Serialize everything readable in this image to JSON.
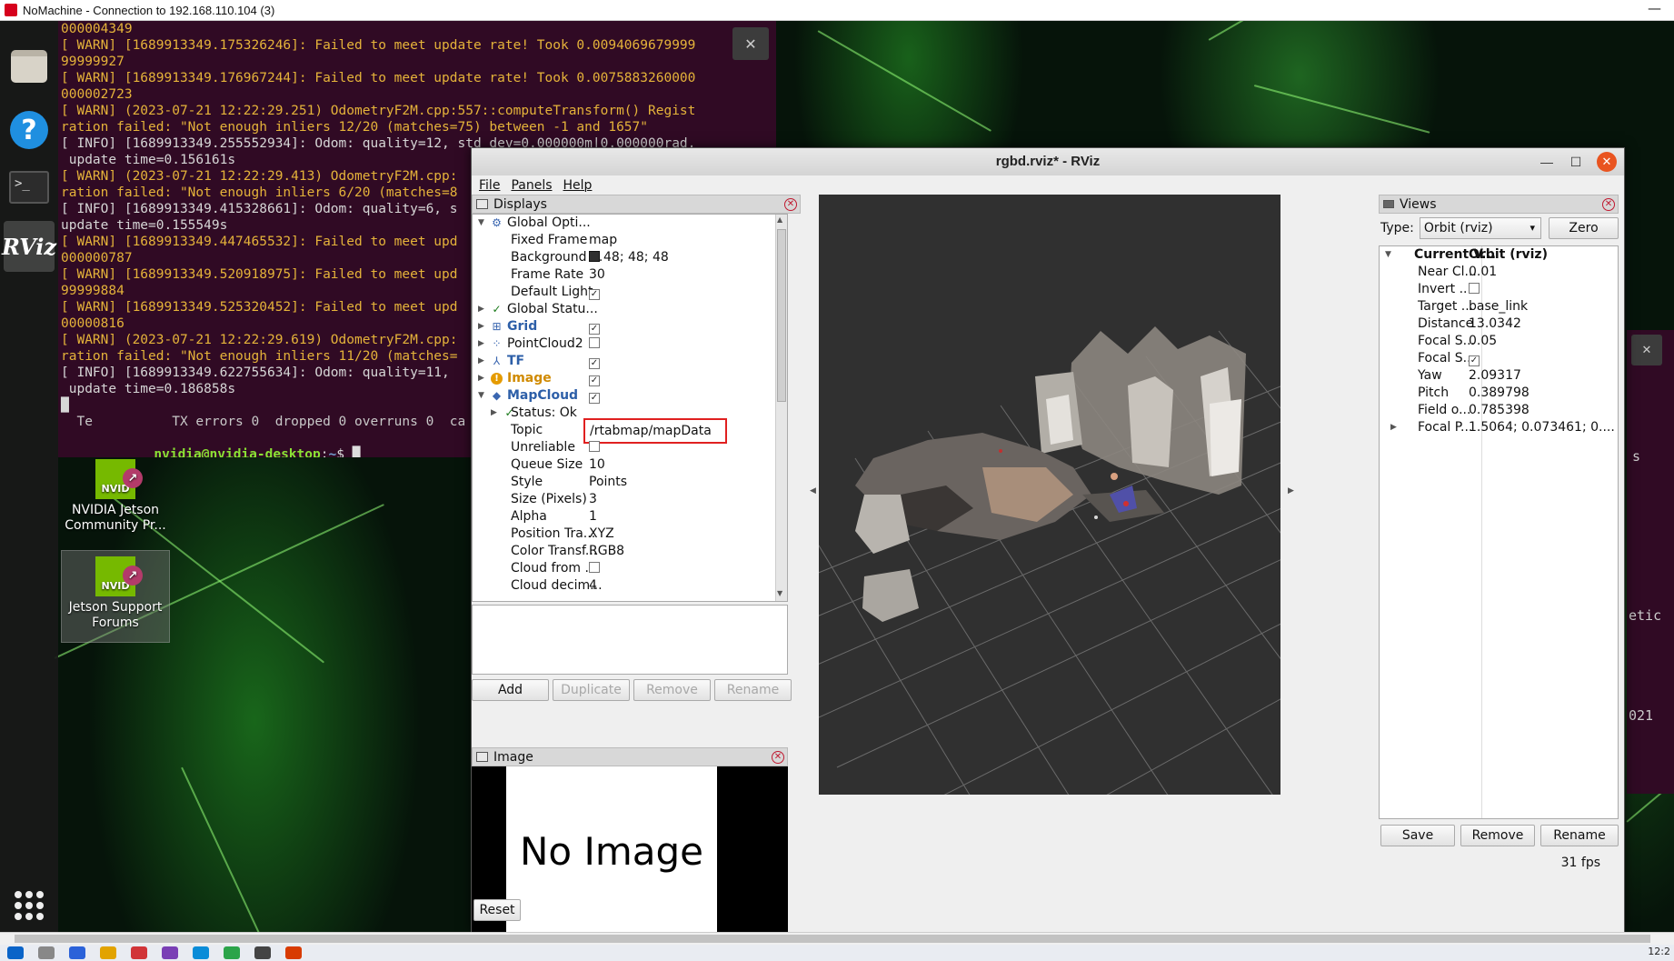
{
  "nomachine": {
    "title": "NoMachine - Connection to 192.168.110.104 (3)"
  },
  "terminal": {
    "lines": [
      {
        "text": "000004349",
        "kind": "warn"
      },
      {
        "text": "[ WARN] [1689913349.175326246]: Failed to meet update rate! Took 0.0094069679999",
        "kind": "warn"
      },
      {
        "text": "99999927",
        "kind": "warn"
      },
      {
        "text": "[ WARN] [1689913349.176967244]: Failed to meet update rate! Took 0.0075883260000",
        "kind": "warn"
      },
      {
        "text": "000002723",
        "kind": "warn"
      },
      {
        "text": "[ WARN] (2023-07-21 12:22:29.251) OdometryF2M.cpp:557::computeTransform() Regist",
        "kind": "warn"
      },
      {
        "text": "ration failed: \"Not enough inliers 12/20 (matches=75) between -1 and 1657\"",
        "kind": "warn"
      },
      {
        "text": "[ INFO] [1689913349.255552934]: Odom: quality=12, std dev=0.000000m|0.000000rad,",
        "kind": "info"
      },
      {
        "text": " update time=0.156161s",
        "kind": "info"
      },
      {
        "text": "[ WARN] (2023-07-21 12:22:29.413) OdometryF2M.cpp:",
        "kind": "warn"
      },
      {
        "text": "ration failed: \"Not enough inliers 6/20 (matches=8",
        "kind": "warn"
      },
      {
        "text": "[ INFO] [1689913349.415328661]: Odom: quality=6, s",
        "kind": "info"
      },
      {
        "text": "update time=0.155549s",
        "kind": "info"
      },
      {
        "text": "[ WARN] [1689913349.447465532]: Failed to meet upd",
        "kind": "warn"
      },
      {
        "text": "000000787",
        "kind": "warn"
      },
      {
        "text": "[ WARN] [1689913349.520918975]: Failed to meet upd",
        "kind": "warn"
      },
      {
        "text": "99999884",
        "kind": "warn"
      },
      {
        "text": "[ WARN] [1689913349.525320452]: Failed to meet upd",
        "kind": "warn"
      },
      {
        "text": "00000816",
        "kind": "warn"
      },
      {
        "text": "[ WARN] (2023-07-21 12:22:29.619) OdometryF2M.cpp:",
        "kind": "warn"
      },
      {
        "text": "ration failed: \"Not enough inliers 11/20 (matches=",
        "kind": "warn"
      },
      {
        "text": "[ INFO] [1689913349.622755634]: Odom: quality=11,",
        "kind": "info"
      },
      {
        "text": " update time=0.186858s",
        "kind": "info"
      },
      {
        "text": "█",
        "kind": "info"
      },
      {
        "text": "  Te          TX errors 0  dropped 0 overruns 0  ca",
        "kind": "dim"
      }
    ],
    "prompt_user": "nvidia@nvidia-desktop",
    "prompt_sep": ":",
    "prompt_path": "~",
    "prompt_end": "$ ",
    "cursor": "█",
    "close_glyph": "✕"
  },
  "desktop_icons": [
    {
      "label": "NVIDIA Jetson Community Pr...",
      "badge": "NVID"
    },
    {
      "label": "Jetson Support Forums",
      "badge": "NVID"
    }
  ],
  "dock": {
    "rviz_label": "RViz",
    "help_glyph": "?",
    "term_glyph": ">_"
  },
  "rviz": {
    "title": "rgbd.rviz* - RViz",
    "window_controls": {
      "minimize": "—",
      "maximize": "☐",
      "close": "✕"
    },
    "menu": [
      "File",
      "Panels",
      "Help"
    ],
    "displays_panel": {
      "title": "Displays",
      "rows": [
        {
          "arrow": "▼",
          "icon": "⚙",
          "label": "Global Opti...",
          "value": "",
          "level": 0
        },
        {
          "label": "Fixed Frame",
          "value": "map",
          "level": 1
        },
        {
          "label": "Background ...",
          "value": "48; 48; 48",
          "swatch": "#303030",
          "level": 1
        },
        {
          "label": "Frame Rate",
          "value": "30",
          "level": 1
        },
        {
          "label": "Default Light",
          "check": true,
          "level": 1
        },
        {
          "arrow": "▶",
          "icon": "✓",
          "label": "Global Statu...",
          "value": "",
          "level": 0
        },
        {
          "arrow": "▶",
          "icon": "⊞",
          "label": "Grid",
          "check": true,
          "style": "bold",
          "level": 0
        },
        {
          "arrow": "▶",
          "icon": "⁘",
          "label": "PointCloud2",
          "check": false,
          "level": 0
        },
        {
          "arrow": "▶",
          "icon": "⅄",
          "label": "TF",
          "check": true,
          "style": "bold",
          "level": 0
        },
        {
          "arrow": "▶",
          "icon": "!",
          "label": "Image",
          "check": true,
          "style": "orange",
          "level": 0
        },
        {
          "arrow": "▼",
          "icon": "◆",
          "label": "MapCloud",
          "check": true,
          "style": "bold",
          "level": 0
        },
        {
          "arrow": "▶",
          "icon": "✓",
          "label": "Status: Ok",
          "value": "",
          "level": 1
        },
        {
          "label": "Topic",
          "value": "/rtabmap/mapData",
          "highlight": true,
          "level": 1
        },
        {
          "label": "Unreliable",
          "check": false,
          "level": 1
        },
        {
          "label": "Queue Size",
          "value": "10",
          "level": 1
        },
        {
          "label": "Style",
          "value": "Points",
          "level": 1
        },
        {
          "label": "Size (Pixels)",
          "value": "3",
          "level": 1
        },
        {
          "label": "Alpha",
          "value": "1",
          "level": 1
        },
        {
          "label": "Position Tra...",
          "value": "XYZ",
          "level": 1
        },
        {
          "label": "Color Transf...",
          "value": "RGB8",
          "level": 1
        },
        {
          "label": "Cloud from ...",
          "check": false,
          "level": 1
        },
        {
          "label": "Cloud decim...",
          "value": "4",
          "level": 1
        }
      ],
      "buttons": {
        "add": "Add",
        "duplicate": "Duplicate",
        "remove": "Remove",
        "rename": "Rename"
      }
    },
    "image_panel": {
      "title": "Image",
      "placeholder": "No Image"
    },
    "reset": "Reset",
    "views_panel": {
      "title": "Views",
      "type_label": "Type:",
      "type_value": "Orbit (rviz)",
      "zero": "Zero",
      "rows": [
        {
          "arrow": "▼",
          "label": "Current V...",
          "value": "Orbit (rviz)",
          "bold": true,
          "level": 0
        },
        {
          "label": "Near Cl...",
          "value": "0.01",
          "level": 1
        },
        {
          "label": "Invert ...",
          "check": false,
          "level": 1
        },
        {
          "label": "Target ...",
          "value": "base_link",
          "level": 1
        },
        {
          "label": "Distance",
          "value": "13.0342",
          "level": 1
        },
        {
          "label": "Focal S...",
          "value": "0.05",
          "level": 1
        },
        {
          "label": "Focal S...",
          "check": true,
          "level": 1
        },
        {
          "label": "Yaw",
          "value": "2.09317",
          "level": 1
        },
        {
          "label": "Pitch",
          "value": "0.389798",
          "level": 1
        },
        {
          "label": "Field o...",
          "value": "0.785398",
          "level": 1
        },
        {
          "arrow": "▶",
          "label": "Focal P...",
          "value": "1.5064; 0.073461; 0....",
          "level": 1
        }
      ],
      "buttons": {
        "save": "Save",
        "remove": "Remove",
        "rename": "Rename"
      },
      "fps": "31 fps"
    }
  },
  "right_window": {
    "close_glyph": "✕",
    "snippets": [
      "s",
      "etic",
      "021"
    ]
  },
  "taskbar": {
    "clock": "12:2"
  }
}
